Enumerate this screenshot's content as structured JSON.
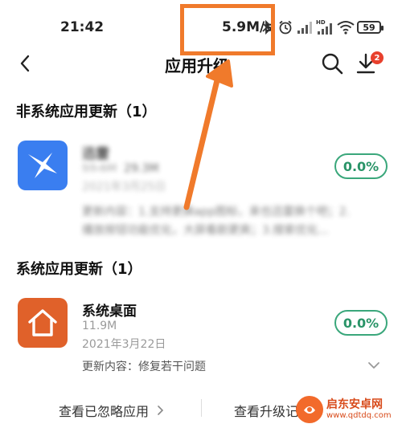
{
  "status_bar": {
    "time": "21:42",
    "net_speed": "5.9M/s",
    "battery": "59",
    "icons": [
      "bluetooth-icon",
      "alarm-icon",
      "signal-icon",
      "hd-signal-icon",
      "wifi-icon",
      "battery-icon"
    ]
  },
  "header": {
    "title": "应用升级",
    "badge_count": "2"
  },
  "sections": {
    "non_system": {
      "title": "非系统应用更新（1）",
      "app": {
        "name": "迅雷",
        "size_old": "59.6M",
        "size_new": "29.3M",
        "date": "2021年3月25日",
        "desc_line1": "更新内容：1.支持更换app图标，来也迅雷换个吧；2.",
        "desc_line2": "播放按钮功能优化，大屏看剧更爽；3.搜索优化...",
        "progress": "0.0%",
        "icon_color": "#3a7ef0"
      }
    },
    "system": {
      "title": "系统应用更新（1）",
      "app": {
        "name": "系统桌面",
        "size": "11.9M",
        "date": "2021年3月22日",
        "desc": "更新内容：修复若干问题",
        "progress": "0.0%",
        "icon_color": "#e0612a"
      }
    }
  },
  "footer": {
    "ignored_label": "查看已忽略应用",
    "history_label": "查看升级记录"
  },
  "watermark": {
    "name": "启东安卓网",
    "url": "www.qdtdq.com"
  },
  "colors": {
    "accent_green": "#3aa77b",
    "highlight_orange": "#f07a2b"
  }
}
